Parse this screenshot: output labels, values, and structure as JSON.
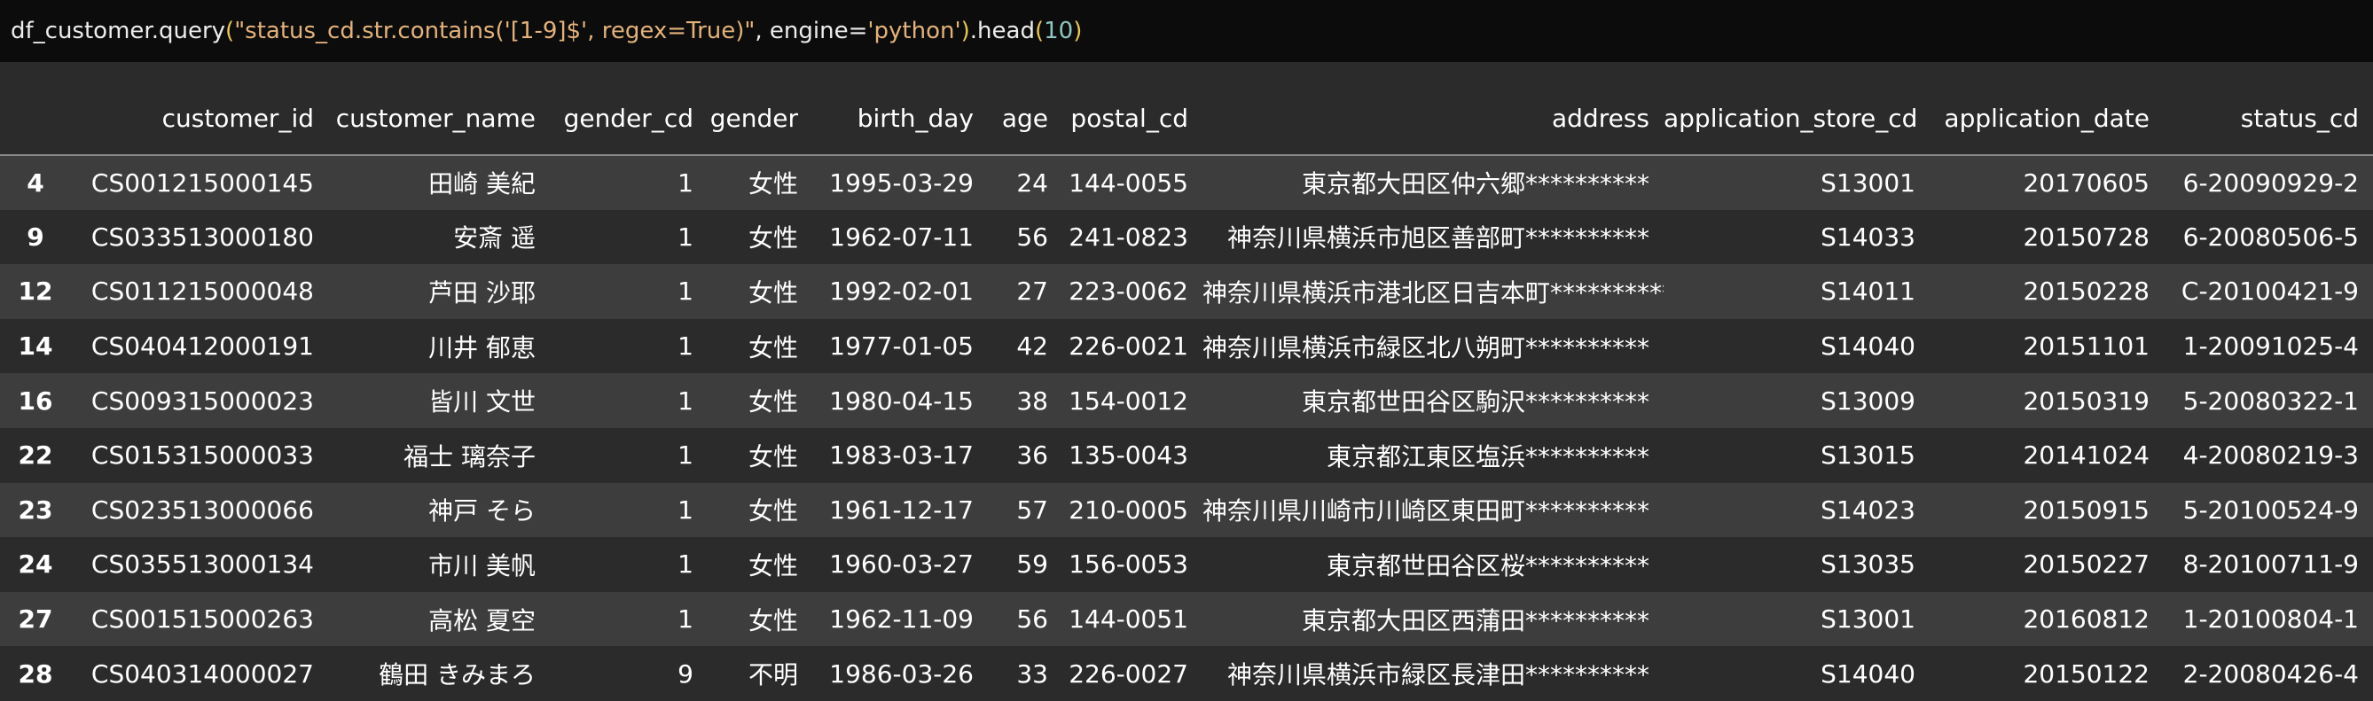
{
  "code": {
    "func": "df_customer.query",
    "open_paren": "(",
    "arg1": "\"status_cd.str.contains('[1-9]$', regex=True)\"",
    "sep1": ", engine=",
    "arg2": "'python'",
    "close_paren": ")",
    "method": ".head",
    "open_paren2": "(",
    "num": "10",
    "close_paren2": ")"
  },
  "table": {
    "columns": [
      "customer_id",
      "customer_name",
      "gender_cd",
      "gender",
      "birth_day",
      "age",
      "postal_cd",
      "address",
      "application_store_cd",
      "application_date",
      "status_cd"
    ],
    "rows": [
      {
        "index": "4",
        "cells": [
          "CS001215000145",
          "田崎 美紀",
          "1",
          "女性",
          "1995-03-29",
          "24",
          "144-0055",
          "東京都大田区仲六郷**********",
          "S13001",
          "20170605",
          "6-20090929-2"
        ]
      },
      {
        "index": "9",
        "cells": [
          "CS033513000180",
          "安斎 遥",
          "1",
          "女性",
          "1962-07-11",
          "56",
          "241-0823",
          "神奈川県横浜市旭区善部町**********",
          "S14033",
          "20150728",
          "6-20080506-5"
        ]
      },
      {
        "index": "12",
        "cells": [
          "CS011215000048",
          "芦田 沙耶",
          "1",
          "女性",
          "1992-02-01",
          "27",
          "223-0062",
          "神奈川県横浜市港北区日吉本町**********",
          "S14011",
          "20150228",
          "C-20100421-9"
        ]
      },
      {
        "index": "14",
        "cells": [
          "CS040412000191",
          "川井 郁恵",
          "1",
          "女性",
          "1977-01-05",
          "42",
          "226-0021",
          "神奈川県横浜市緑区北八朔町**********",
          "S14040",
          "20151101",
          "1-20091025-4"
        ]
      },
      {
        "index": "16",
        "cells": [
          "CS009315000023",
          "皆川 文世",
          "1",
          "女性",
          "1980-04-15",
          "38",
          "154-0012",
          "東京都世田谷区駒沢**********",
          "S13009",
          "20150319",
          "5-20080322-1"
        ]
      },
      {
        "index": "22",
        "cells": [
          "CS015315000033",
          "福士 璃奈子",
          "1",
          "女性",
          "1983-03-17",
          "36",
          "135-0043",
          "東京都江東区塩浜**********",
          "S13015",
          "20141024",
          "4-20080219-3"
        ]
      },
      {
        "index": "23",
        "cells": [
          "CS023513000066",
          "神戸 そら",
          "1",
          "女性",
          "1961-12-17",
          "57",
          "210-0005",
          "神奈川県川崎市川崎区東田町**********",
          "S14023",
          "20150915",
          "5-20100524-9"
        ]
      },
      {
        "index": "24",
        "cells": [
          "CS035513000134",
          "市川 美帆",
          "1",
          "女性",
          "1960-03-27",
          "59",
          "156-0053",
          "東京都世田谷区桜**********",
          "S13035",
          "20150227",
          "8-20100711-9"
        ]
      },
      {
        "index": "27",
        "cells": [
          "CS001515000263",
          "高松 夏空",
          "1",
          "女性",
          "1962-11-09",
          "56",
          "144-0051",
          "東京都大田区西蒲田**********",
          "S13001",
          "20160812",
          "1-20100804-1"
        ]
      },
      {
        "index": "28",
        "cells": [
          "CS040314000027",
          "鶴田 きみまろ",
          "9",
          "不明",
          "1986-03-26",
          "33",
          "226-0027",
          "神奈川県横浜市緑区長津田**********",
          "S14040",
          "20150122",
          "2-20080426-4"
        ]
      }
    ]
  }
}
